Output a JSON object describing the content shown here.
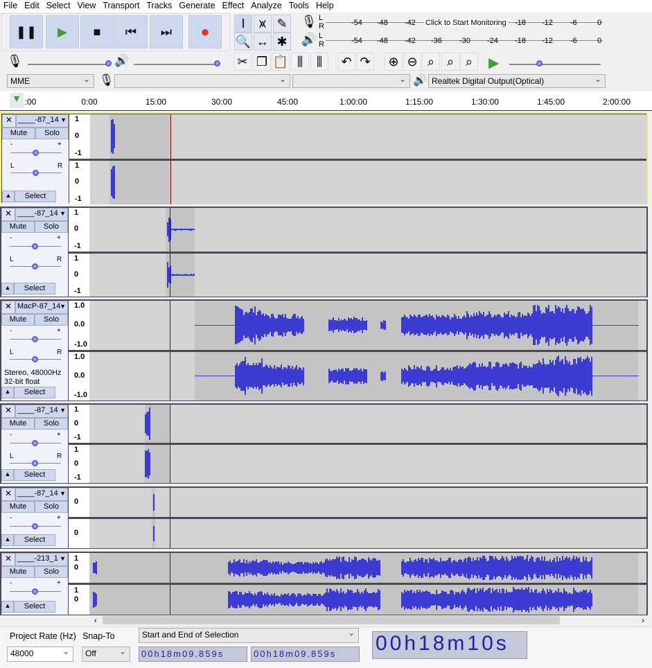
{
  "menu": [
    "File",
    "Edit",
    "Select",
    "View",
    "Transport",
    "Tracks",
    "Generate",
    "Effect",
    "Analyze",
    "Tools",
    "Help"
  ],
  "transport": [
    {
      "name": "pause",
      "glyph": "❚❚"
    },
    {
      "name": "play",
      "glyph": "▶"
    },
    {
      "name": "stop",
      "glyph": "■"
    },
    {
      "name": "skip-start",
      "glyph": "⏮"
    },
    {
      "name": "skip-end",
      "glyph": "⏭"
    },
    {
      "name": "record",
      "glyph": "●"
    }
  ],
  "colors": {
    "accent": "#3c3cd2",
    "play": "#3ca03c",
    "record": "#e03030",
    "selection_border": "#f0f080"
  },
  "meters": {
    "record_ticks": [
      "-54",
      "-48",
      "-42",
      "-18",
      "-12",
      "-6",
      "0"
    ],
    "record_hint": "Click to Start Monitoring",
    "play_ticks": [
      "-54",
      "-48",
      "-42",
      "-36",
      "-30",
      "-24",
      "-18",
      "-12",
      "-6",
      "0"
    ],
    "lr": [
      "L",
      "R"
    ]
  },
  "devices": {
    "host": "MME",
    "input": "",
    "channels": "",
    "output": "Realtek Digital Output(Optical)"
  },
  "ruler": [
    ":00",
    "0:00",
    "15:00",
    "30:00",
    "45:00",
    "1:00:00",
    "1:15:00",
    "1:30:00",
    "1:45:00",
    "2:00:00"
  ],
  "labels": {
    "mute": "Mute",
    "solo": "Solo",
    "select": "Select",
    "minus": "-",
    "plus": "+",
    "L": "L",
    "R": "R"
  },
  "tracks": [
    {
      "name": "____-87_14",
      "scale": [
        "1",
        "0",
        "-1"
      ],
      "selected": true
    },
    {
      "name": "____-87_14",
      "scale": [
        "1",
        "0",
        "-1"
      ]
    },
    {
      "name": "MacP-87_14",
      "scale": [
        "1.0",
        "0.0",
        "-1.0"
      ],
      "info1": "Stereo, 48000Hz",
      "info2": "32-bit float"
    },
    {
      "name": "____-87_14",
      "scale": [
        "1",
        "0",
        "-1"
      ]
    },
    {
      "name": "____-87_14",
      "scale": [
        "0"
      ]
    },
    {
      "name": "____-213_1",
      "scale": [
        "1",
        "0"
      ]
    }
  ],
  "bottom": {
    "rate_label": "Project Rate (Hz)",
    "rate": "48000",
    "snap_label": "Snap-To",
    "snap": "Off",
    "sel_mode": "Start and End of Selection",
    "sel_start": "00h18m09.859s",
    "sel_end": "00h18m09.859s",
    "audio_pos": "00h18m10s"
  }
}
